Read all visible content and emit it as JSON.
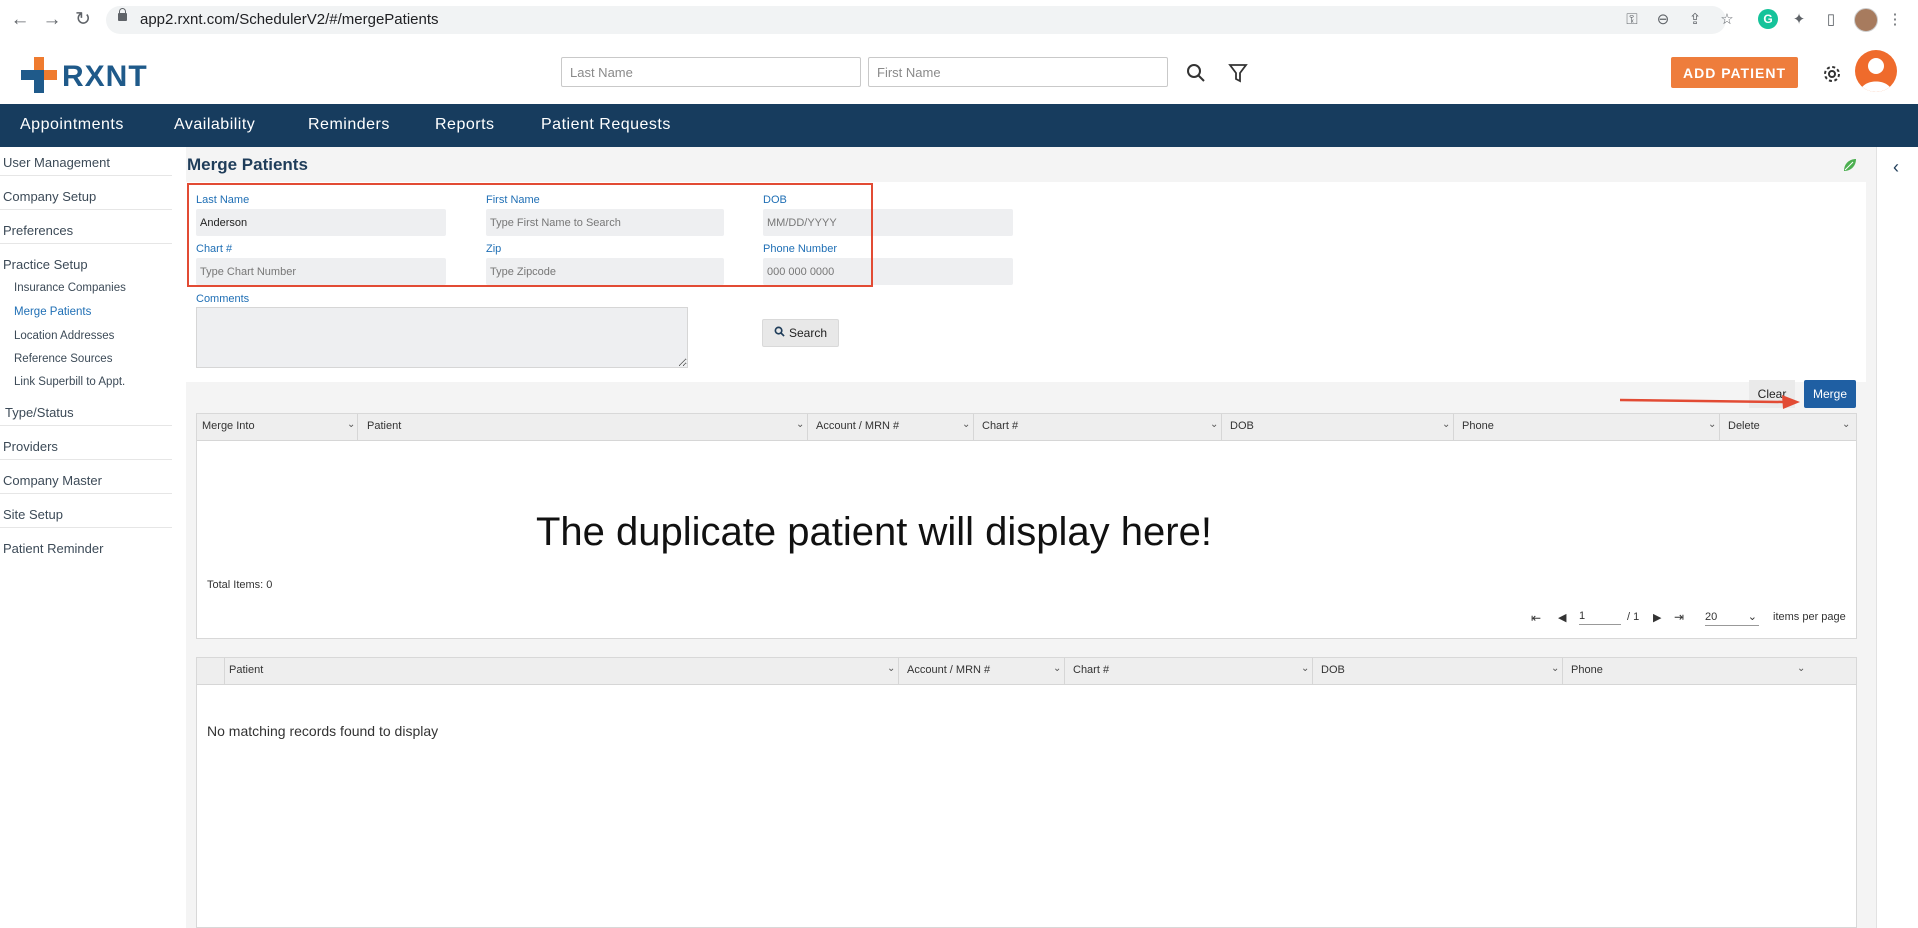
{
  "browser": {
    "url": "app2.rxnt.com/SchedulerV2/#/mergePatients"
  },
  "header": {
    "logo_text": "RXNT",
    "last_name_placeholder": "Last Name",
    "first_name_placeholder": "First Name",
    "add_patient_label": "ADD PATIENT"
  },
  "nav": {
    "items": [
      "Appointments",
      "Availability",
      "Reminders",
      "Reports",
      "Patient Requests"
    ]
  },
  "sidebar": {
    "user_management": "User Management",
    "company_setup": "Company Setup",
    "preferences": "Preferences",
    "practice_setup": "Practice Setup",
    "sub_items": [
      "Insurance Companies",
      "Merge Patients",
      "Location Addresses",
      "Reference Sources",
      "Link Superbill to Appt."
    ],
    "type_status": "Type/Status",
    "providers": "Providers",
    "company_master": "Company Master",
    "site_setup": "Site Setup",
    "patient_reminder": "Patient Reminder"
  },
  "page": {
    "title": "Merge Patients"
  },
  "form": {
    "last_name_label": "Last Name",
    "last_name_value": "Anderson",
    "first_name_label": "First Name",
    "first_name_placeholder": "Type First Name to Search",
    "dob_label": "DOB",
    "dob_placeholder": "MM/DD/YYYY",
    "chart_label": "Chart #",
    "chart_placeholder": "Type Chart Number",
    "zip_label": "Zip",
    "zip_placeholder": "Type Zipcode",
    "phone_label": "Phone Number",
    "phone_placeholder": "000 000 0000",
    "comments_label": "Comments",
    "search_label": "Search"
  },
  "actions": {
    "clear_label": "Clear",
    "merge_label": "Merge"
  },
  "merge_grid": {
    "columns": [
      "Merge Into",
      "Patient",
      "Account / MRN #",
      "Chart #",
      "DOB",
      "Phone",
      "Delete"
    ],
    "overlay_message": "The duplicate patient will display here!",
    "total_items": "Total Items: 0",
    "page_current": "1",
    "page_total": "/ 1",
    "page_size": "20",
    "items_per_page": "items per page"
  },
  "results_grid": {
    "columns": [
      "Patient",
      "Account / MRN #",
      "Chart #",
      "DOB",
      "Phone"
    ],
    "empty_message": "No matching records found to display"
  },
  "colors": {
    "navbar": "#173c5e",
    "accent_orange": "#ee7d3c",
    "merge_blue": "#1f5fa3",
    "highlight_red": "#e24b34"
  }
}
